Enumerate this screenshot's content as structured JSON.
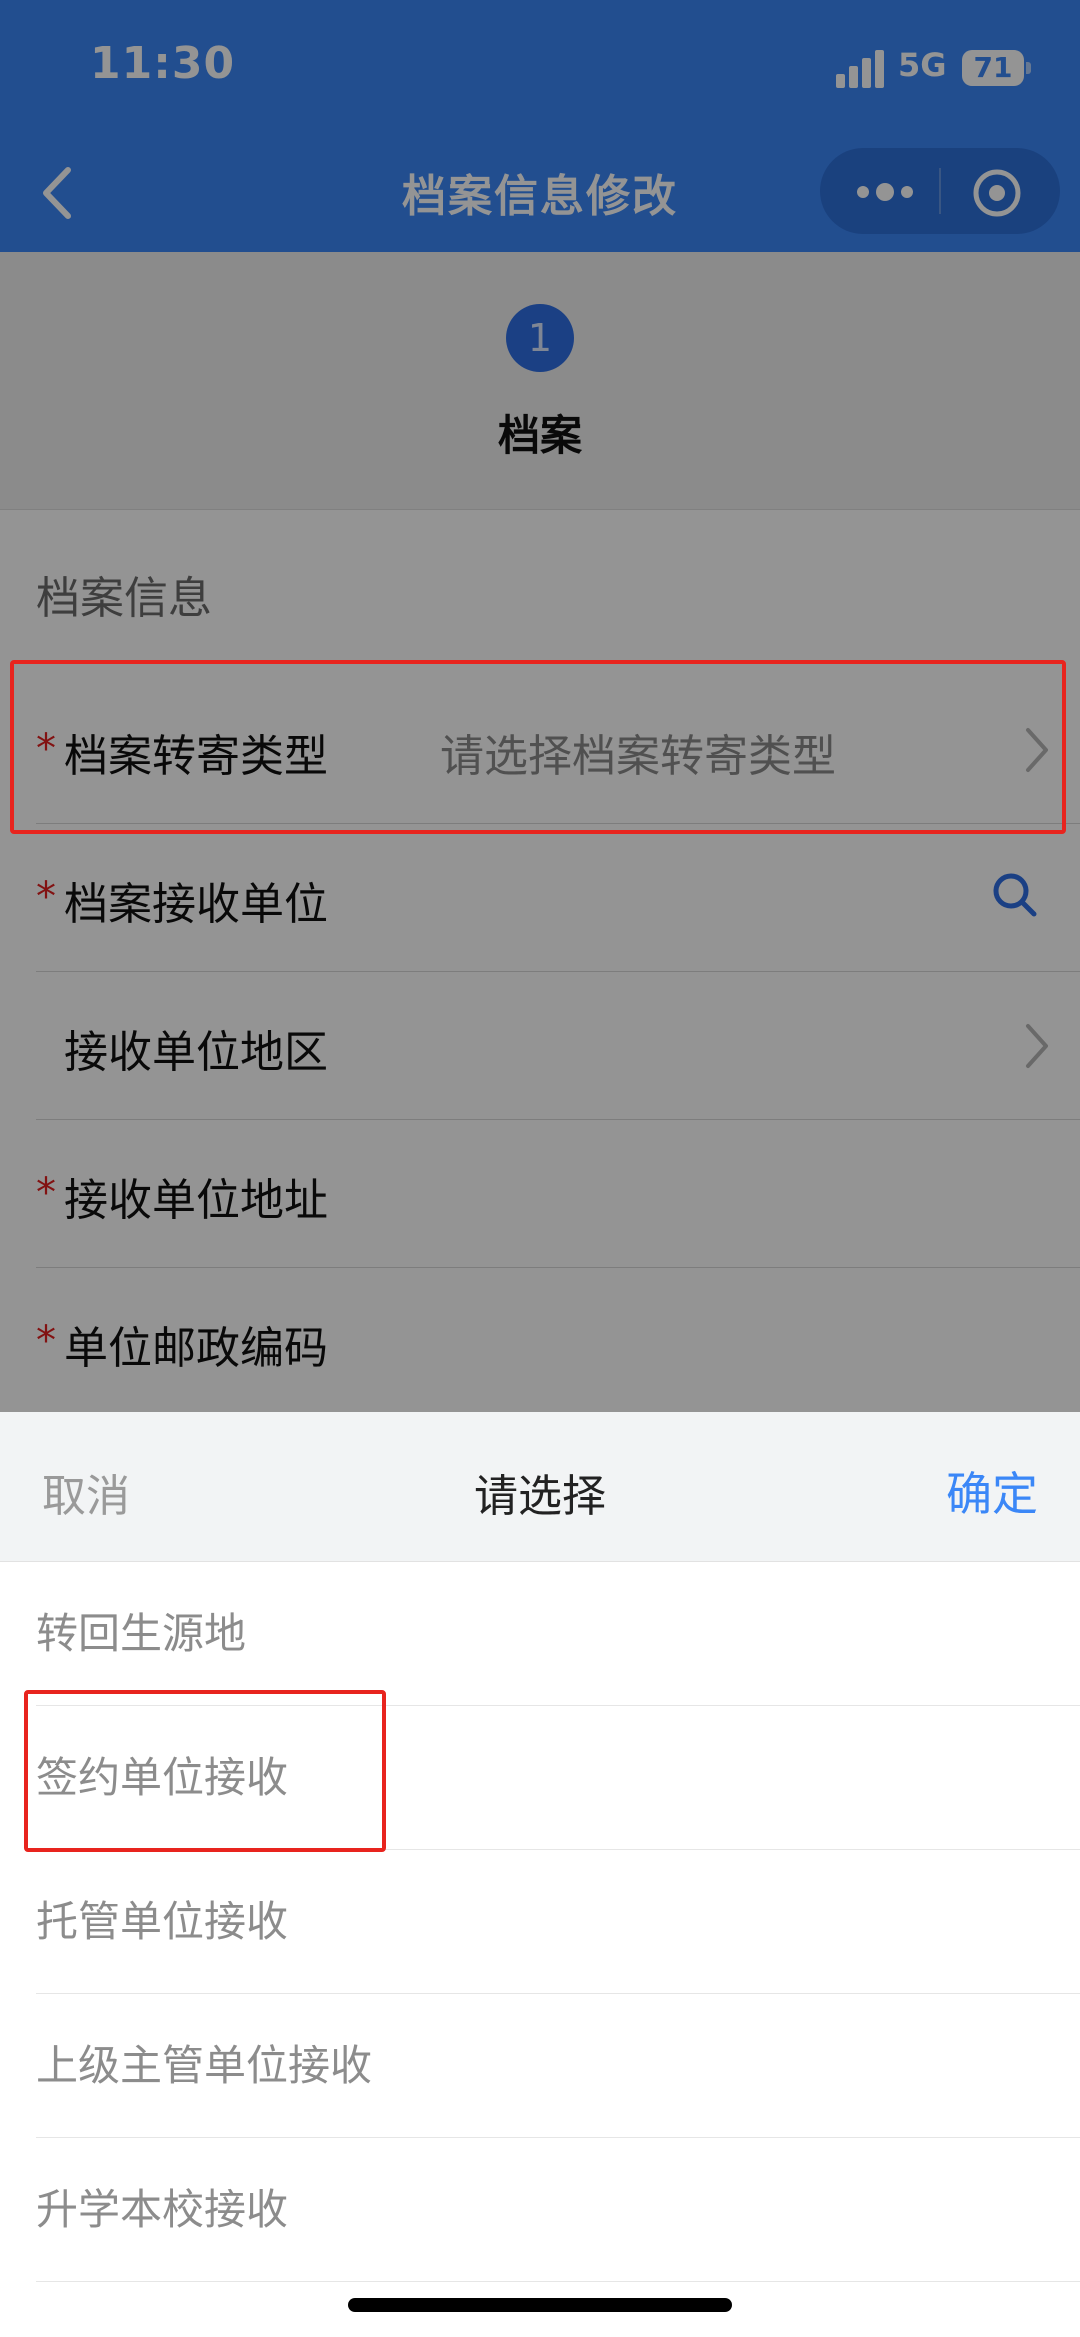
{
  "status_bar": {
    "time": "11:30",
    "network": "5G",
    "battery": "71"
  },
  "nav": {
    "title": "档案信息修改",
    "back_icon": "chevron-left-icon",
    "more_icon": "more-dots-icon",
    "close_icon": "target-circle-icon"
  },
  "stepper": {
    "step_number": "1",
    "step_label": "档案"
  },
  "form": {
    "section_title": "档案信息",
    "rows": [
      {
        "required": "*",
        "label": "档案转寄类型",
        "value": "请选择档案转寄类型",
        "icon": "chevron-right-icon"
      },
      {
        "required": "*",
        "label": "档案接收单位",
        "value": "",
        "icon": "search-icon"
      },
      {
        "required": "",
        "label": "接收单位地区",
        "value": "",
        "icon": "chevron-right-icon"
      },
      {
        "required": "*",
        "label": "接收单位地址",
        "value": "",
        "icon": ""
      },
      {
        "required": "*",
        "label": "单位邮政编码",
        "value": "",
        "icon": ""
      }
    ]
  },
  "picker": {
    "cancel_label": "取消",
    "title": "请选择",
    "confirm_label": "确定",
    "options": [
      "转回生源地",
      "签约单位接收",
      "托管单位接收",
      "上级主管单位接收",
      "升学本校接收"
    ]
  },
  "colors": {
    "primary": "#3b87f7",
    "highlight_box": "#e8241e",
    "required_star": "#e02020"
  }
}
